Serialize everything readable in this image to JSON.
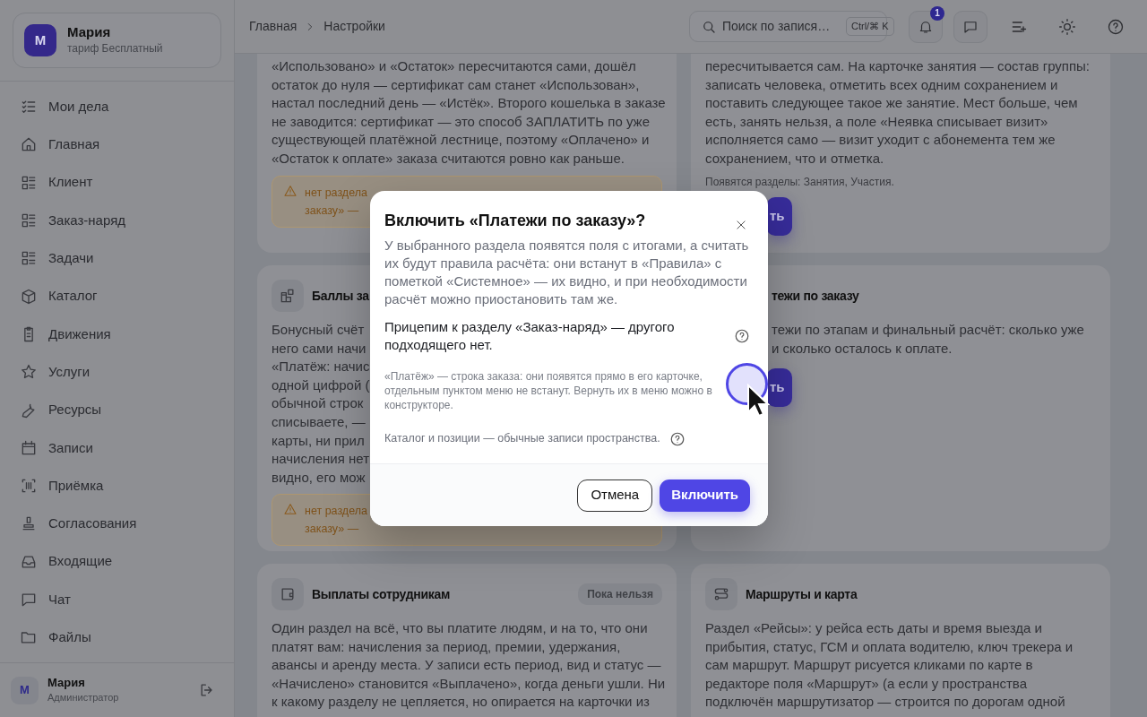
{
  "sidebar": {
    "profile": {
      "initial": "М",
      "name": "Мария",
      "plan": "тариф Бесплатный"
    },
    "nav": [
      {
        "label": "Мои дела"
      },
      {
        "label": "Главная"
      },
      {
        "label": "Клиент"
      },
      {
        "label": "Заказ-наряд"
      },
      {
        "label": "Задачи"
      },
      {
        "label": "Каталог"
      },
      {
        "label": "Движения"
      },
      {
        "label": "Услуги"
      },
      {
        "label": "Ресурсы"
      },
      {
        "label": "Записи"
      },
      {
        "label": "Приёмка"
      },
      {
        "label": "Согласования"
      },
      {
        "label": "Входящие"
      },
      {
        "label": "Чат"
      },
      {
        "label": "Файлы"
      }
    ],
    "user": {
      "initial": "М",
      "name": "Мария",
      "role": "Администратор"
    }
  },
  "header": {
    "breadcrumbs": [
      "Главная",
      "Настройки"
    ],
    "search": {
      "placeholder": "Поиск по запися…",
      "shortcut": "Ctrl/⌘ K"
    },
    "notification_count": "1"
  },
  "cards": [
    [
      {
        "text_lines": [
          "«Использовано» и «Остаток» пересчитаются сами, дошёл",
          "остаток до нуля — сертификат сам станет «Использован»,",
          "настал последний день — «Истёк». Второго кошелька в заказе",
          "не заводится: сертификат — это способ ЗАПЛАТИТЬ по уже",
          "существующей платёжной лестнице, поэтому «Оплачено» и",
          "«Остаток к оплате» заказа считаются ровно как раньше."
        ],
        "warning_lines": [
          "нет раздела",
          "заказу» —"
        ]
      },
      {
        "text_lines": [
          "пересчитывается сам. На карточке занятия — состав группы:",
          "записать человека, отметить всех одним сохранением и",
          "поставить следующее такое же занятие. Мест больше, чем",
          "есть, занять нельзя, а поле «Неявка списывает визит»",
          "исполняется само — визит уходит с абонемента тем же",
          "сохранением, что и отметка."
        ],
        "note": "Появятся разделы: Занятия, Участия.",
        "button": "ть"
      }
    ],
    [
      {
        "title": "Баллы за",
        "text_lines": [
          "Бонусный счёт",
          "него сами начи",
          "«Платёж: начис",
          "одной цифрой (",
          "обычной строк",
          "списываете, —",
          "карты, ни прил",
          "начисления нет",
          "видно, его мож"
        ],
        "warning_lines": [
          "нет раздела",
          "заказу» —"
        ]
      },
      {
        "title": "тежи по заказу",
        "text_lines": [
          "тежи по этапам и финальный расчёт: сколько уже",
          "и сколько осталось к оплате."
        ],
        "button": "ть"
      }
    ],
    [
      {
        "title": "Выплаты сотрудникам",
        "badge": "Пока нельзя",
        "text_lines": [
          "Один раздел на всё, что вы платите людям, и на то, что они",
          "платят вам: начисления за период, премии, удержания,",
          "авансы и аренду места. У записи есть период, вид и статус —",
          "«Начислено» становится «Выплачено», когда деньги ушли. Ни",
          "к какому разделу не цепляется, но опирается на карточки из"
        ]
      },
      {
        "title": "Маршруты и карта",
        "text_lines": [
          "Раздел «Рейсы»: у рейса есть даты и время выезда и",
          "прибытия, статус, ГСМ и оплата водителю, ключ трекера и",
          "сам маршрут. Маршрут рисуется кликами по карте в",
          "редакторе поля «Маршрут» (а если у пространства",
          "подключён маршрутизатор — строится по дорогам одной"
        ]
      }
    ]
  ],
  "modal": {
    "title": "Включить «Платежи по заказу»?",
    "description": "У выбранного раздела появятся поля с итогами, а считать их будут правила расчёта: они встанут в «Правила» с пометкой «Системное» — их видно, и при необходимости расчёт можно приостановить там же.",
    "attach": "Прицепим к разделу «Заказ-наряд» — другого подходящего нет.",
    "attach_note": "«Платёж» — строка заказа: они появятся прямо в его карточке, отдельным пунктом меню не встанут. Вернуть их в меню можно в конструкторе.",
    "catalog": "Каталог и позиции — обычные записи пространства.",
    "cancel": "Отмена",
    "confirm": "Включить"
  }
}
